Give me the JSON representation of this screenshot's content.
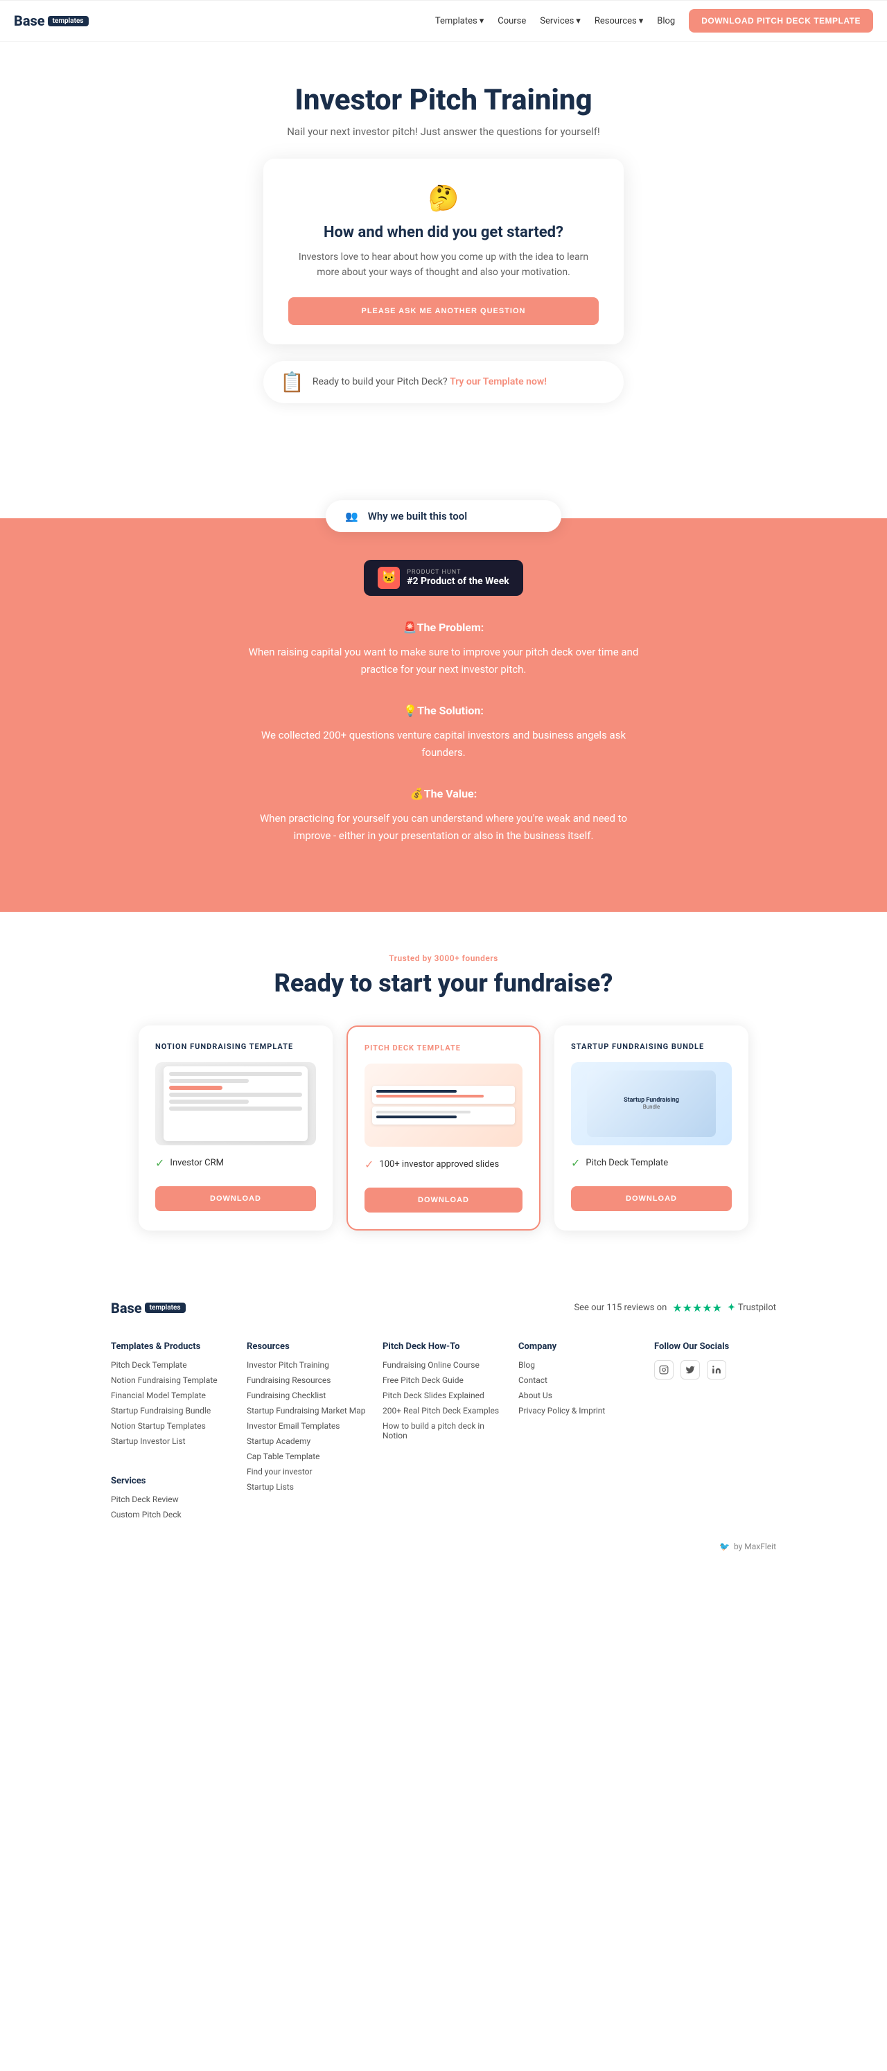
{
  "hero": {
    "title": "Investor Pitch Training",
    "subtitle": "Nail your next investor pitch! Just answer the questions for yourself!"
  },
  "question_card": {
    "emoji": "🤔",
    "question": "How and when did you get started?",
    "description": "Investors love to hear about how you come up with the idea to learn more about your ways of thought and also your motivation.",
    "button_label": "PLEASE ASK ME ANOTHER QUESTION"
  },
  "pitch_banner": {
    "text": "Ready to build your Pitch Deck?",
    "link_text": "Try our Template now!"
  },
  "why": {
    "emoji": "👥",
    "label": "Why we built this tool"
  },
  "product_hunt": {
    "label": "PRODUCT HUNT",
    "badge": "#2 Product of the Week"
  },
  "sections": [
    {
      "title": "🚨The Problem:",
      "text": "When raising capital you want to make sure to improve your pitch deck over time and practice for your next investor pitch."
    },
    {
      "title": "💡The Solution:",
      "text": "We collected 200+ questions venture capital investors and business angels ask founders."
    },
    {
      "title": "💰The Value:",
      "text": "When practicing for yourself you can understand where you're weak and need to improve - either in your presentation or also in the business itself."
    }
  ],
  "products_section": {
    "trusted_label": "Trusted by 3000+ founders",
    "heading": "Ready to start your fundraise?"
  },
  "cards": [
    {
      "id": "notion",
      "title": "NOTION FUNDRAISING TEMPLATE",
      "featured": false,
      "feature": "Investor CRM",
      "button": "DOWNLOAD"
    },
    {
      "id": "pitch",
      "title": "PITCH DECK TEMPLATE",
      "featured": true,
      "feature": "100+ investor approved slides",
      "button": "DOWNLOAD"
    },
    {
      "id": "bundle",
      "title": "STARTUP FUNDRAISING BUNDLE",
      "featured": false,
      "feature": "Pitch Deck Template",
      "button": "DOWNLOAD"
    }
  ],
  "navbar": {
    "brand": "Base",
    "tag": "templates",
    "links": [
      {
        "label": "Templates",
        "has_dropdown": true
      },
      {
        "label": "Course",
        "has_dropdown": false
      },
      {
        "label": "Services",
        "has_dropdown": true
      },
      {
        "label": "Resources",
        "has_dropdown": true
      },
      {
        "label": "Blog",
        "has_dropdown": false
      }
    ],
    "cta": "DOWNLOAD PITCH DECK TEMPLATE"
  },
  "footer": {
    "brand": "Base",
    "tag": "templates",
    "trustpilot_text": "See our 115 reviews on",
    "trustpilot_brand": "Trustpilot",
    "cols": [
      {
        "heading": "Templates & Products",
        "links": [
          "Pitch Deck Template",
          "Notion Fundraising Template",
          "Financial Model Template",
          "Startup Fundraising Bundle",
          "Notion Startup Templates",
          "Startup Investor List"
        ]
      },
      {
        "heading": "Services",
        "links": [
          "Pitch Deck Review",
          "Custom Pitch Deck"
        ]
      },
      {
        "heading": "Resources",
        "links": [
          "Investor Pitch Training",
          "Fundraising Resources",
          "Fundraising Checklist",
          "Startup Fundraising Market Map",
          "Investor Email Templates",
          "Startup Academy",
          "Cap Table Template",
          "Find your investor",
          "Startup Lists"
        ]
      },
      {
        "heading": "Pitch Deck How-To",
        "links": [
          "Fundraising Online Course",
          "Free Pitch Deck Guide",
          "Pitch Deck Slides Explained",
          "200+ Real Pitch Deck Examples",
          "How to build a pitch deck in Notion"
        ]
      },
      {
        "heading": "Company",
        "links": [
          "Blog",
          "Contact",
          "About Us",
          "Privacy Policy & Imprint"
        ]
      },
      {
        "heading": "Follow Our Socials",
        "links": []
      }
    ],
    "by_text": "by MaxFleit"
  }
}
